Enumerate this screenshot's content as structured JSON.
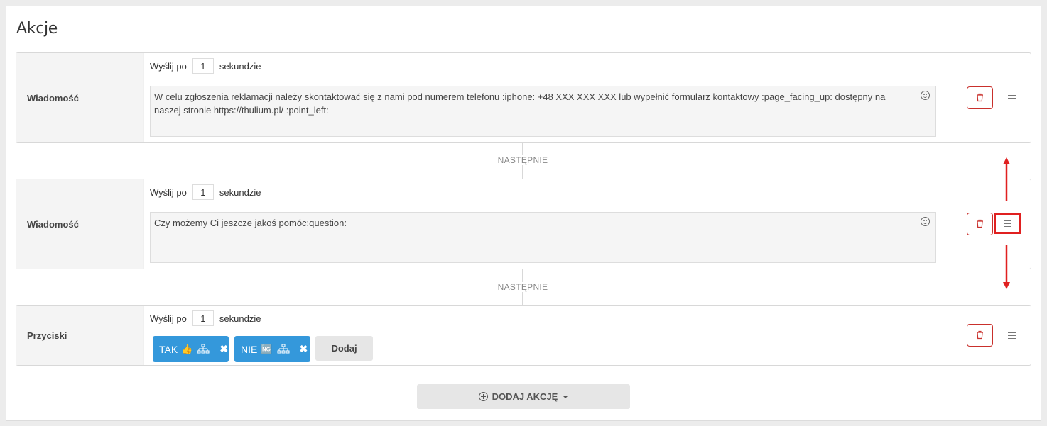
{
  "page": {
    "title": "Akcje"
  },
  "delay": {
    "prefix": "Wyślij po",
    "suffix": "sekundzie"
  },
  "actions": [
    {
      "type_label": "Wiadomość",
      "delay_value": "1",
      "message": "W celu zgłoszenia reklamacji należy skontaktować się z nami pod numerem telefonu :iphone: +48 XXX XXX XXX lub wypełnić formularz kontaktowy :page_facing_up: dostępny na naszej stronie https://thulium.pl/ :point_left:"
    },
    {
      "type_label": "Wiadomość",
      "delay_value": "1",
      "message": "Czy możemy Ci jeszcze jakoś pomóc:question:"
    },
    {
      "type_label": "Przyciski",
      "delay_value": "1",
      "buttons": [
        {
          "label": "TAK",
          "emoji": "👍"
        },
        {
          "label": "NIE",
          "emoji": "🆖"
        }
      ],
      "add_label": "Dodaj"
    }
  ],
  "separator_label": "NASTĘPNIE",
  "add_action_label": "DODAJ AKCJĘ",
  "icons": {
    "emoji_picker": "smiley-icon",
    "delete": "trash-icon",
    "reorder": "drag-handle-icon",
    "flow": "sitemap-icon",
    "remove": "close-icon",
    "add": "plus-circle-icon",
    "dropdown": "caret-down-icon"
  },
  "colors": {
    "chip": "#3498db",
    "danger": "#c9302c",
    "annotation": "#e02020"
  }
}
